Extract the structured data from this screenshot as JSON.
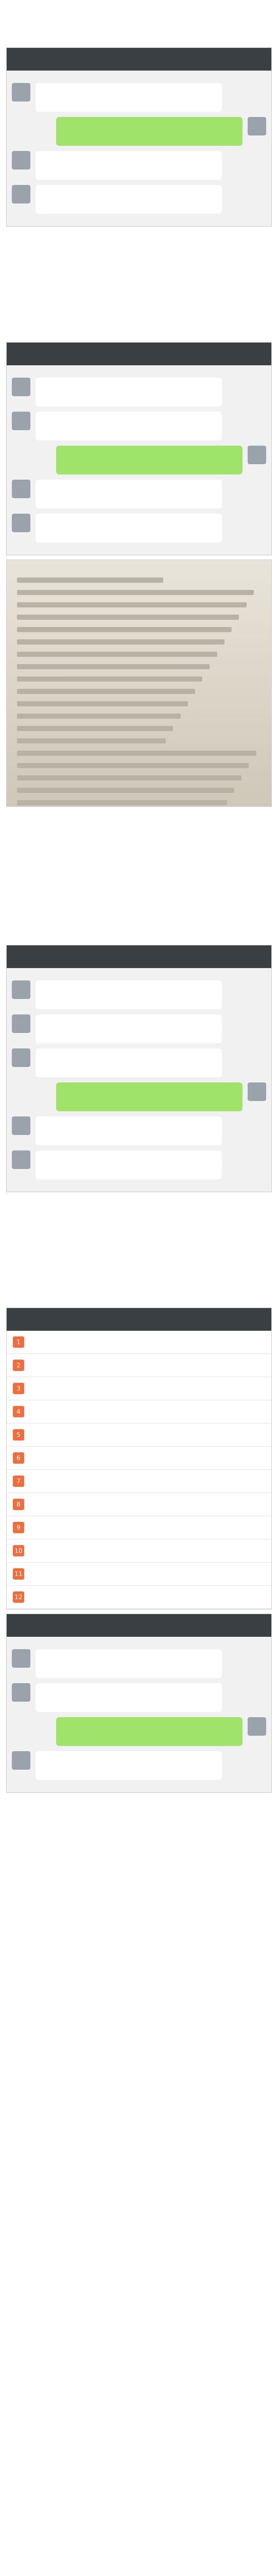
{
  "note": "",
  "blocks": [
    {
      "kind": "para",
      "text": ""
    },
    {
      "kind": "chat",
      "title": "",
      "messages": [
        {
          "side": "left",
          "text": ""
        },
        {
          "side": "right",
          "text": ""
        },
        {
          "side": "left",
          "text": ""
        },
        {
          "side": "left",
          "text": ""
        }
      ]
    },
    {
      "kind": "para",
      "text": ""
    },
    {
      "kind": "heading",
      "text": ""
    },
    {
      "kind": "para",
      "text": ""
    },
    {
      "kind": "chat",
      "title": "",
      "messages": [
        {
          "side": "left",
          "text": ""
        },
        {
          "side": "left",
          "text": ""
        },
        {
          "side": "right",
          "text": ""
        },
        {
          "side": "left",
          "text": ""
        },
        {
          "side": "left",
          "text": ""
        }
      ]
    },
    {
      "kind": "photo",
      "caption": ""
    },
    {
      "kind": "para",
      "text": ""
    },
    {
      "kind": "para",
      "text": ""
    },
    {
      "kind": "para",
      "text": ""
    },
    {
      "kind": "chat",
      "title": "",
      "messages": [
        {
          "side": "left",
          "text": ""
        },
        {
          "side": "left",
          "text": ""
        },
        {
          "side": "left",
          "text": ""
        },
        {
          "side": "right",
          "text": ""
        },
        {
          "side": "left",
          "text": ""
        },
        {
          "side": "left",
          "text": ""
        }
      ]
    },
    {
      "kind": "para",
      "text": ""
    },
    {
      "kind": "heading",
      "text": ""
    },
    {
      "kind": "para",
      "text": ""
    },
    {
      "kind": "hotlist",
      "title": "",
      "items": [
        "",
        "",
        "",
        "",
        "",
        "",
        "",
        "",
        "",
        "",
        "",
        ""
      ]
    },
    {
      "kind": "chat",
      "title": "",
      "messages": [
        {
          "side": "left",
          "text": ""
        },
        {
          "side": "left",
          "text": ""
        },
        {
          "side": "right",
          "text": ""
        },
        {
          "side": "left",
          "text": ""
        }
      ]
    }
  ]
}
